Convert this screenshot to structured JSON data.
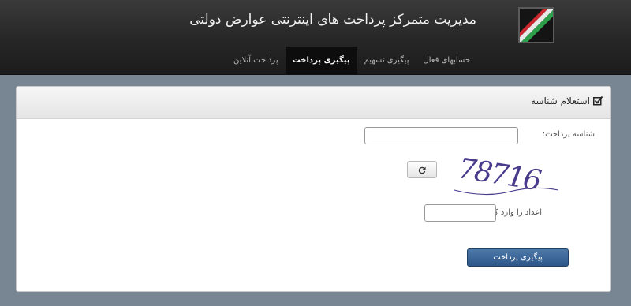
{
  "header": {
    "title": "مدیریت متمرکز پرداخت های اینترنتی عوارض دولتی",
    "logo_icon": "road-logo-icon",
    "nav": [
      {
        "label": "پرداخت آنلاین",
        "active": false
      },
      {
        "label": "پیگیری پرداخت",
        "active": true
      },
      {
        "label": "پیگیری تسهیم",
        "active": false
      },
      {
        "label": "حسابهای فعال",
        "active": false
      }
    ]
  },
  "panel": {
    "title": "استعلام شناسه",
    "title_icon": "checkbox-icon",
    "payment_id_label": "شناسه پرداخت:",
    "payment_id_value": "",
    "captcha_text": "78716",
    "refresh_icon": "refresh-icon",
    "captcha_label": "اعداد را وارد کنید",
    "captcha_value": "",
    "submit_label": "پیگیری پرداخت"
  },
  "colors": {
    "header_bg": "#262626",
    "page_bg": "#788592",
    "active_tab_bg": "#0d0d0d",
    "primary_button": "#3a6494",
    "captcha_ink": "#4a3a8c"
  }
}
